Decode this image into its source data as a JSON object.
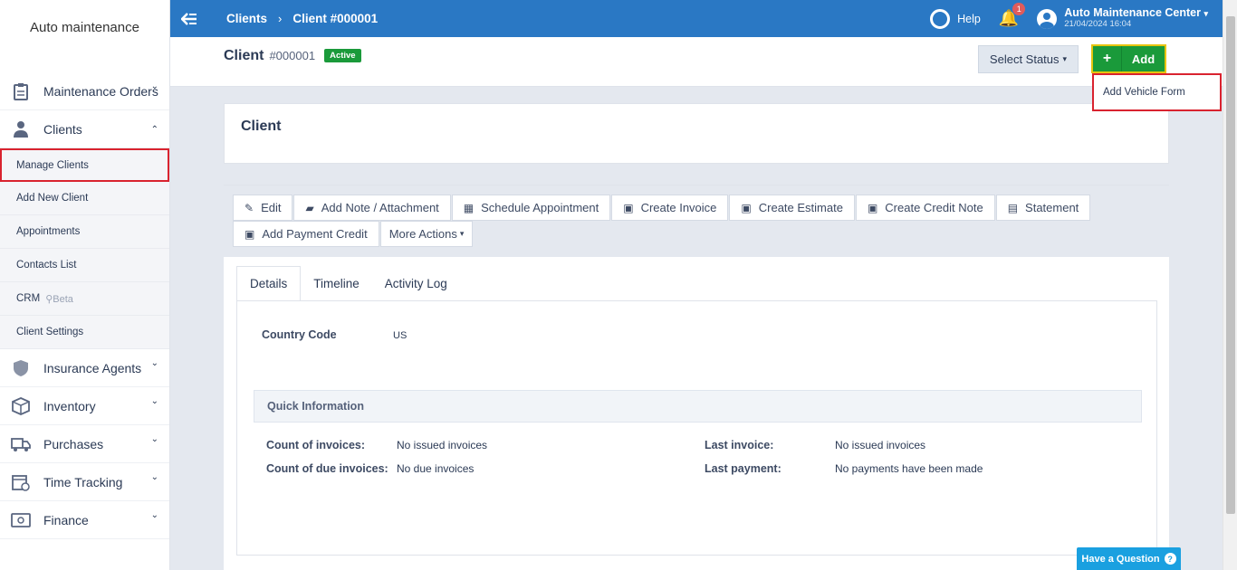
{
  "sidebar": {
    "brand": "Auto maintenance",
    "items": [
      {
        "label": "Maintenance Orders",
        "icon": "clipboard-icon",
        "chevron": "⌄"
      },
      {
        "label": "Clients",
        "icon": "user-tie-icon",
        "chevron": "⌃"
      }
    ],
    "sub_items": [
      {
        "label": "Manage Clients"
      },
      {
        "label": "Add New Client"
      },
      {
        "label": "Appointments"
      },
      {
        "label": "Contacts List"
      },
      {
        "label": "CRM",
        "extra": "Beta"
      },
      {
        "label": "Client Settings"
      }
    ],
    "items_after": [
      {
        "label": "Insurance Agents",
        "icon": "shield-icon",
        "chevron": "⌄"
      },
      {
        "label": "Inventory",
        "icon": "box-icon",
        "chevron": "⌄"
      },
      {
        "label": "Purchases",
        "icon": "truck-icon",
        "chevron": "⌄"
      },
      {
        "label": "Time Tracking",
        "icon": "calendar-clock-icon",
        "chevron": "⌄"
      },
      {
        "label": "Finance",
        "icon": "banknote-icon",
        "chevron": "⌄"
      }
    ]
  },
  "topbar": {
    "breadcrumb_1": "Clients",
    "breadcrumb_sep": "›",
    "breadcrumb_2": "Client #000001",
    "help": "Help",
    "notif_count": "1",
    "user_name": "Auto Maintenance Center",
    "user_date": "21/04/2024 16:04"
  },
  "header": {
    "title": "Client",
    "number": "#000001",
    "status": "Active",
    "select_status": "Select Status",
    "add": "Add",
    "dropdown_item": "Add Vehicle Form"
  },
  "client_card": {
    "title": "Client"
  },
  "actions": {
    "row1": [
      {
        "label": "Edit",
        "icon": "pencil-icon",
        "glyph": "✎"
      },
      {
        "label": "Add Note / Attachment",
        "icon": "book-icon",
        "glyph": "▰"
      },
      {
        "label": "Schedule Appointment",
        "icon": "calendar-icon",
        "glyph": "▦"
      },
      {
        "label": "Create Invoice",
        "icon": "money-icon",
        "glyph": "▣"
      },
      {
        "label": "Create Estimate",
        "icon": "money-icon",
        "glyph": "▣"
      },
      {
        "label": "Create Credit Note",
        "icon": "money-icon",
        "glyph": "▣"
      },
      {
        "label": "Statement",
        "icon": "calculator-icon",
        "glyph": "▤"
      }
    ],
    "row2": [
      {
        "label": "Add Payment Credit",
        "icon": "money-icon",
        "glyph": "▣"
      }
    ],
    "more": "More Actions"
  },
  "tabs": [
    "Details",
    "Timeline",
    "Activity Log"
  ],
  "details": {
    "country_code_label": "Country Code",
    "country_code_value": "US",
    "quick_info": "Quick Information",
    "count_invoices_label": "Count of invoices:",
    "count_invoices_value": "No issued invoices",
    "count_due_label": "Count of due invoices:",
    "count_due_value": "No due invoices",
    "last_invoice_label": "Last invoice:",
    "last_invoice_value": "No issued invoices",
    "last_payment_label": "Last payment:",
    "last_payment_value": "No payments have been made"
  },
  "chat": {
    "label": "Have a Question",
    "q": "?"
  },
  "colors": {
    "topbar": "#2a78c4",
    "success": "#1a9a3a",
    "highlight": "#d9232f",
    "chat": "#1aa0e0"
  }
}
